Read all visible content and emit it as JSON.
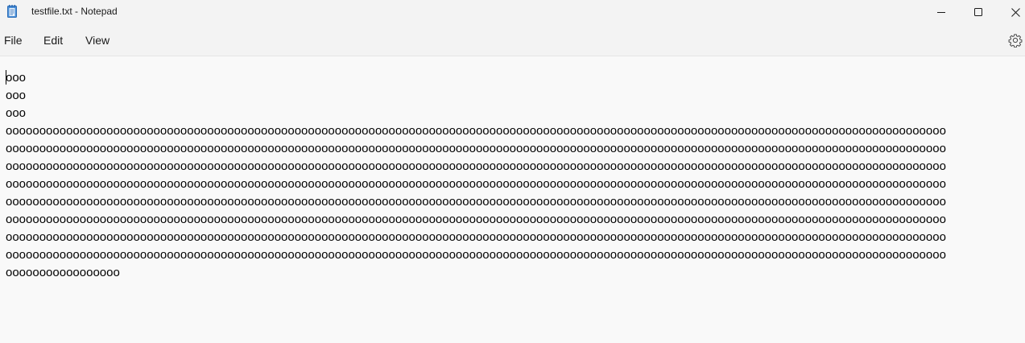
{
  "window": {
    "title": "testfile.txt - Notepad",
    "icons": {
      "app": "notepad-icon",
      "minimize": "minimize-icon",
      "maximize": "maximize-icon",
      "close": "close-icon",
      "settings": "gear-icon"
    }
  },
  "menu": {
    "file": "File",
    "edit": "Edit",
    "view": "View"
  },
  "editor": {
    "lines": [
      "ooo",
      "ooo",
      "ooo",
      "oooooooooooooooooooooooooooooooooooooooooooooooooooooooooooooooooooooooooooooooooooooooooooooooooooooooooooooooooooooooooooooooooooooooooooo",
      "oooooooooooooooooooooooooooooooooooooooooooooooooooooooooooooooooooooooooooooooooooooooooooooooooooooooooooooooooooooooooooooooooooooooooooo",
      "oooooooooooooooooooooooooooooooooooooooooooooooooooooooooooooooooooooooooooooooooooooooooooooooooooooooooooooooooooooooooooooooooooooooooooo",
      "oooooooooooooooooooooooooooooooooooooooooooooooooooooooooooooooooooooooooooooooooooooooooooooooooooooooooooooooooooooooooooooooooooooooooooo",
      "oooooooooooooooooooooooooooooooooooooooooooooooooooooooooooooooooooooooooooooooooooooooooooooooooooooooooooooooooooooooooooooooooooooooooooo",
      "oooooooooooooooooooooooooooooooooooooooooooooooooooooooooooooooooooooooooooooooooooooooooooooooooooooooooooooooooooooooooooooooooooooooooooo",
      "oooooooooooooooooooooooooooooooooooooooooooooooooooooooooooooooooooooooooooooooooooooooooooooooooooooooooooooooooooooooooooooooooooooooooooo",
      "oooooooooooooooooooooooooooooooooooooooooooooooooooooooooooooooooooooooooooooooooooooooooooooooooooooooooooooooooooooooooooooooooooooooooooo",
      "ooooooooooooooooo"
    ]
  }
}
